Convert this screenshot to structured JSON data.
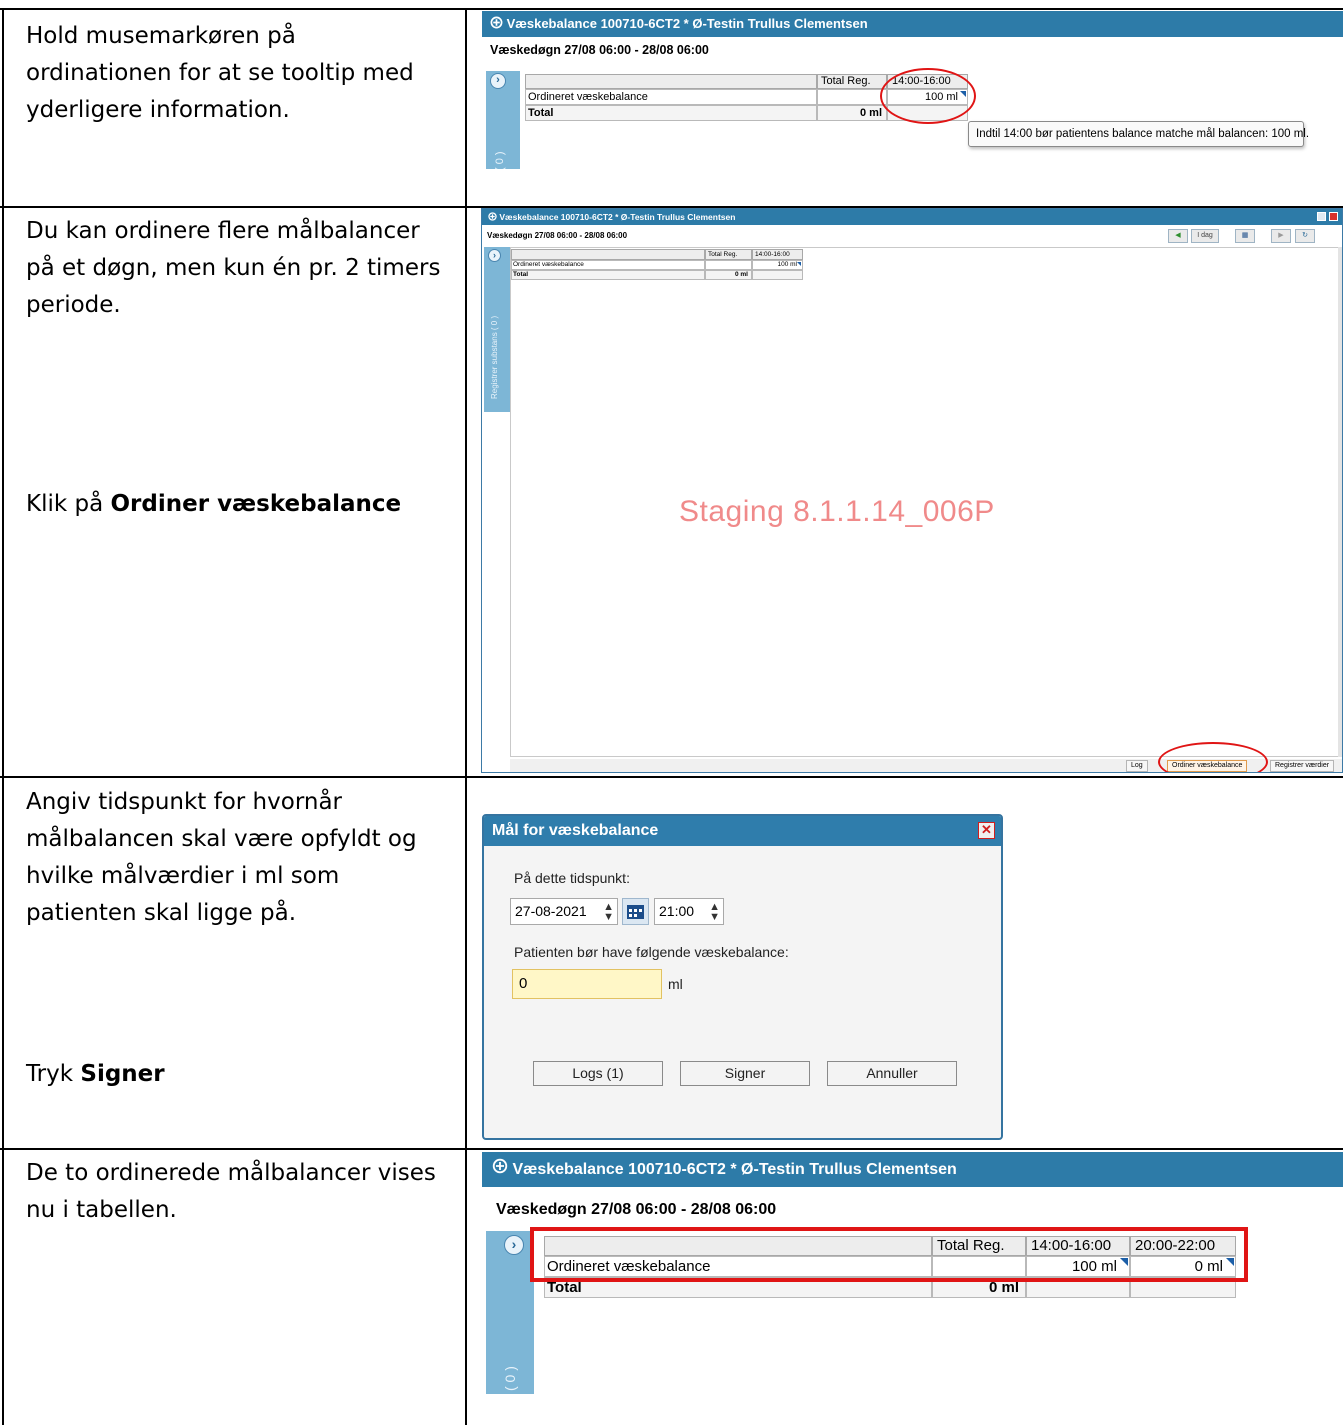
{
  "rows": [
    {
      "instructions": [
        "Hold musemarkøren på ordinationen for at se tooltip med yderligere information."
      ],
      "shot": {
        "title": "Væskebalance 100710-6CT2 * Ø-Testin Trullus Clementsen",
        "subtitle": "Væskedøgn 27/08 06:00 - 28/08 06:00",
        "headers": [
          "",
          "Total Reg.",
          "14:00-16:00"
        ],
        "row_label": "Ordineret væskebalance",
        "row_values": [
          "",
          "100 ml"
        ],
        "total_label": "Total",
        "total_value": "0 ml",
        "sidebar_text": "( 0 )",
        "tooltip": "Indtil 14:00 bør patientens balance matche mål balancen: 100 ml."
      }
    },
    {
      "instruction_1": "Du kan ordinere flere målbalancer på et døgn, men kun én pr. 2 timers periode.",
      "instruction_2_prefix": "Klik på ",
      "instruction_2_bold": "Ordiner væskebalance",
      "shot": {
        "title": "Væskebalance 100710-6CT2 * Ø-Testin Trullus Clementsen",
        "subtitle": "Væskedøgn 27/08 06:00 - 28/08 06:00",
        "headers": [
          "",
          "Total Reg.",
          "14:00-16:00"
        ],
        "row_label": "Ordineret væskebalance",
        "row_value": "100 ml",
        "total_label": "Total",
        "total_value": "0 ml",
        "sidebar_text": "Registrer substans ( 0 )",
        "watermark": "Staging 8.1.1.14_006P",
        "toolbar": {
          "today": "I dag"
        },
        "bottom_buttons": {
          "log": "Log",
          "ordiner": "Ordiner væskebalance",
          "registrer": "Registrer værdier"
        }
      }
    },
    {
      "instruction_1": "Angiv tidspunkt for hvornår målbalancen skal være opfyldt og hvilke målværdier i ml som patienten skal ligge på.",
      "instruction_2_prefix": "Tryk ",
      "instruction_2_bold": "Signer",
      "dialog": {
        "title": "Mål for væskebalance",
        "time_label": "På dette tidspunkt:",
        "date_value": "27-08-2021",
        "time_value": "21:00",
        "balance_label": "Patienten bør have følgende væskebalance:",
        "balance_value": "0",
        "unit": "ml",
        "buttons": {
          "logs": "Logs (1)",
          "sign": "Signer",
          "cancel": "Annuller"
        }
      }
    },
    {
      "instructions": [
        "De to ordinerede målbalancer vises nu i tabellen."
      ],
      "shot": {
        "title": "Væskebalance 100710-6CT2 * Ø-Testin Trullus Clementsen",
        "subtitle": "Væskedøgn 27/08 06:00 - 28/08 06:00",
        "headers": [
          "",
          "Total Reg.",
          "14:00-16:00",
          "20:00-22:00"
        ],
        "row_label": "Ordineret væskebalance",
        "row_values": [
          "",
          "100 ml",
          "0 ml"
        ],
        "total_label": "Total",
        "total_value": "0 ml",
        "sidebar_text": "( 0 )"
      }
    }
  ],
  "colors": {
    "title_bar": "#2d7ba8",
    "highlight": "#e01515",
    "watermark": "#f08a8a",
    "input_bg": "#fff7c7"
  }
}
